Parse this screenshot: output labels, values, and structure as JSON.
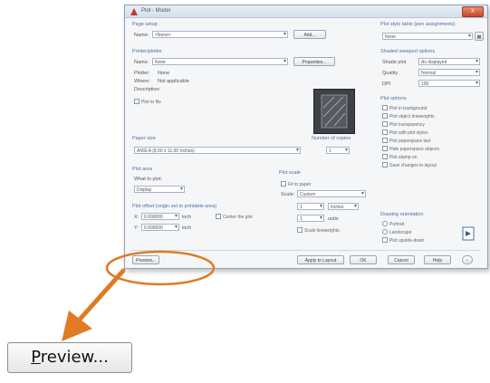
{
  "dialog": {
    "title": "Plot - Model",
    "close": "X",
    "page_setup": {
      "header": "Page setup",
      "name_label": "Name:",
      "name_value": "<None>",
      "add_button": "Add..."
    },
    "printer": {
      "header": "Printer/plotter",
      "name_label": "Name:",
      "name_value": "None",
      "properties_button": "Properties...",
      "plotter_label": "Plotter:",
      "plotter_value": "None",
      "where_label": "Where:",
      "where_value": "Not applicable",
      "description_label": "Description:",
      "plot_to_file": "Plot to file"
    },
    "paper_size": {
      "header": "Paper size",
      "value": "ANSI A (8.50 x 11.00 Inches)"
    },
    "copies": {
      "header": "Number of copies",
      "value": "1"
    },
    "plot_area": {
      "header": "Plot area",
      "what_label": "What to plot:",
      "what_value": "Display"
    },
    "plot_offset": {
      "header": "Plot offset (origin set to printable area)",
      "x_label": "X:",
      "x_value": "0.000000",
      "y_label": "Y:",
      "y_value": "0.000000",
      "unit": "inch",
      "center": "Center the plot"
    },
    "plot_scale": {
      "header": "Plot scale",
      "fit": "Fit to paper",
      "scale_label": "Scale:",
      "scale_value": "Custom",
      "inches_value": "1",
      "inches_unit": "inches",
      "units_value": "1",
      "units_unit": "units",
      "lineweights": "Scale lineweights"
    },
    "style_table": {
      "header": "Plot style table (pen assignments)",
      "value": "None"
    },
    "viewport_options": {
      "header": "Shaded viewport options",
      "shade_label": "Shade plot",
      "shade_value": "As displayed",
      "quality_label": "Quality",
      "quality_value": "Normal",
      "dpi_label": "DPI",
      "dpi_value": "100"
    },
    "plot_options": {
      "header": "Plot options",
      "items": [
        "Plot in background",
        "Plot object lineweights",
        "Plot transparency",
        "Plot with plot styles",
        "Plot paperspace last",
        "Hide paperspace objects",
        "Plot stamp on",
        "Save changes to layout"
      ]
    },
    "orientation": {
      "header": "Drawing orientation",
      "portrait": "Portrait",
      "landscape": "Landscape",
      "upside_down": "Plot upside-down"
    },
    "footer": {
      "preview": "Preview...",
      "apply": "Apply to Layout",
      "ok": "OK",
      "cancel": "Cancel",
      "help": "Help"
    }
  },
  "callout": {
    "preview_button": "Preview...",
    "mnemonic": "P",
    "rest": "review...",
    "accent_color": "#e07b24"
  }
}
